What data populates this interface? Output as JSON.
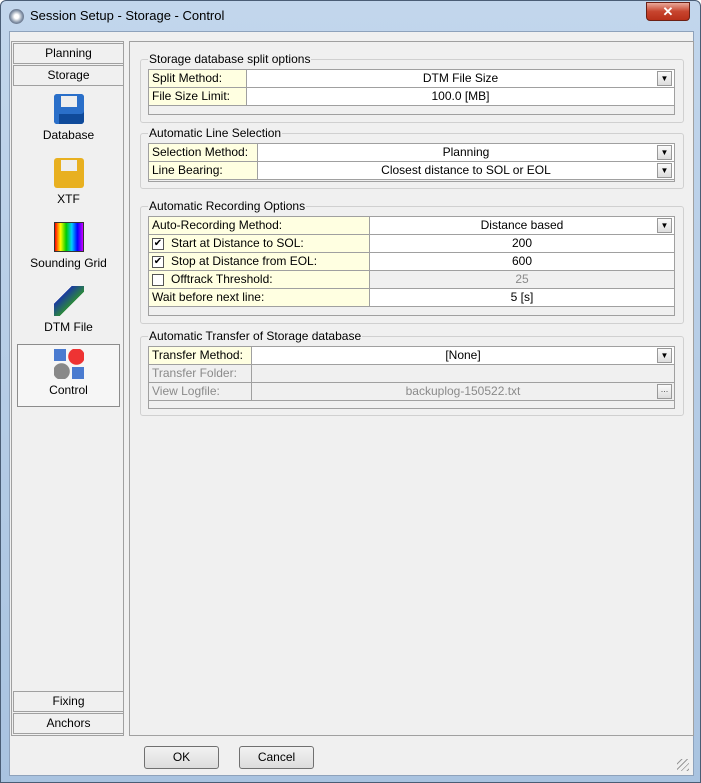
{
  "window": {
    "title": "Session Setup - Storage -  Control",
    "close": "✕"
  },
  "sidebar": {
    "tabs": [
      "Planning",
      "Storage"
    ],
    "items": [
      {
        "label": "Database",
        "icon": "floppy-disk-icon"
      },
      {
        "label": "XTF",
        "icon": "floppy-disk-yellow-icon"
      },
      {
        "label": "Sounding Grid",
        "icon": "sounding-grid-icon"
      },
      {
        "label": "DTM File",
        "icon": "dtm-file-icon"
      },
      {
        "label": "Control",
        "icon": "control-icon"
      }
    ],
    "bottom_tabs": [
      "Fixing",
      "Anchors"
    ]
  },
  "groups": {
    "split": {
      "title": "Storage database split options",
      "rows": [
        {
          "label": "Split Method:",
          "value": "DTM File Size"
        },
        {
          "label": "File Size Limit:",
          "value": "100.0 [MB]"
        }
      ]
    },
    "line": {
      "title": "Automatic Line Selection",
      "rows": [
        {
          "label": "Selection Method:",
          "value": "Planning"
        },
        {
          "label": "Line Bearing:",
          "value": "Closest distance to SOL or EOL"
        }
      ]
    },
    "recording": {
      "title": "Automatic Recording Options",
      "rows": [
        {
          "label": "Auto-Recording Method:",
          "value": "Distance based"
        },
        {
          "label": "Start at Distance to SOL:",
          "value": "200",
          "checked": true
        },
        {
          "label": "Stop at Distance from EOL:",
          "value": "600",
          "checked": true
        },
        {
          "label": "Offtrack Threshold:",
          "value": "25",
          "checked": false
        },
        {
          "label": "Wait before next line:",
          "value": "5 [s]"
        }
      ]
    },
    "transfer": {
      "title": "Automatic Transfer of Storage database",
      "rows": [
        {
          "label": "Transfer Method:",
          "value": "[None]"
        },
        {
          "label": "Transfer Folder:",
          "value": ""
        },
        {
          "label": "View Logfile:",
          "value": "backuplog-150522.txt",
          "button": "..."
        }
      ]
    }
  },
  "buttons": {
    "ok": "OK",
    "cancel": "Cancel"
  }
}
